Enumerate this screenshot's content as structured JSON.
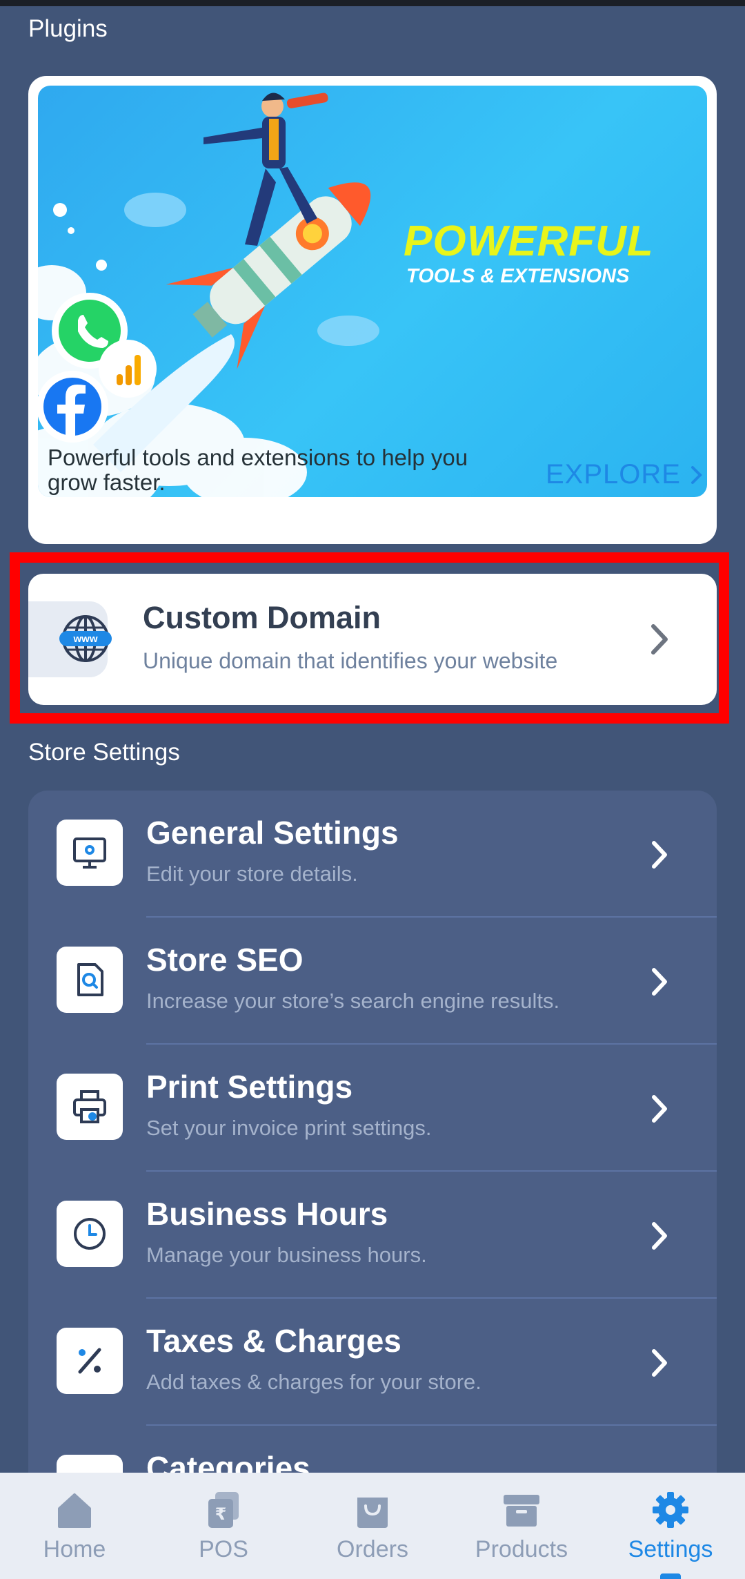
{
  "plugins": {
    "section_title": "Plugins",
    "banner_title": "POWERFUL",
    "banner_subtitle": "TOOLS & EXTENSIONS",
    "description": "Powerful tools and extensions to help you grow faster.",
    "explore_label": "EXPLORE"
  },
  "custom_domain": {
    "title": "Custom Domain",
    "subtitle": "Unique domain that identifies your website",
    "icon_text": "www"
  },
  "store_settings": {
    "section_title": "Store Settings",
    "items": [
      {
        "title": "General Settings",
        "subtitle": "Edit your store details.",
        "icon": "monitor-gear-icon"
      },
      {
        "title": "Store SEO",
        "subtitle": "Increase your store’s search engine results.",
        "icon": "search-document-icon"
      },
      {
        "title": "Print Settings",
        "subtitle": "Set your invoice print settings.",
        "icon": "printer-icon"
      },
      {
        "title": "Business Hours",
        "subtitle": "Manage your business hours.",
        "icon": "clock-icon"
      },
      {
        "title": "Taxes & Charges",
        "subtitle": "Add taxes & charges for your store.",
        "icon": "percent-icon"
      },
      {
        "title": "Categories",
        "subtitle": "",
        "icon": "categories-icon"
      }
    ]
  },
  "bottom_nav": {
    "items": [
      {
        "label": "Home",
        "icon": "home-icon"
      },
      {
        "label": "POS",
        "icon": "pos-icon"
      },
      {
        "label": "Orders",
        "icon": "shopping-bag-icon"
      },
      {
        "label": "Products",
        "icon": "archive-box-icon"
      },
      {
        "label": "Settings",
        "icon": "gear-icon"
      }
    ],
    "active": "Settings"
  },
  "colors": {
    "background": "#415578",
    "accent": "#1e88e5",
    "highlight_border": "#ff0000",
    "banner_title": "#e8f51a"
  }
}
